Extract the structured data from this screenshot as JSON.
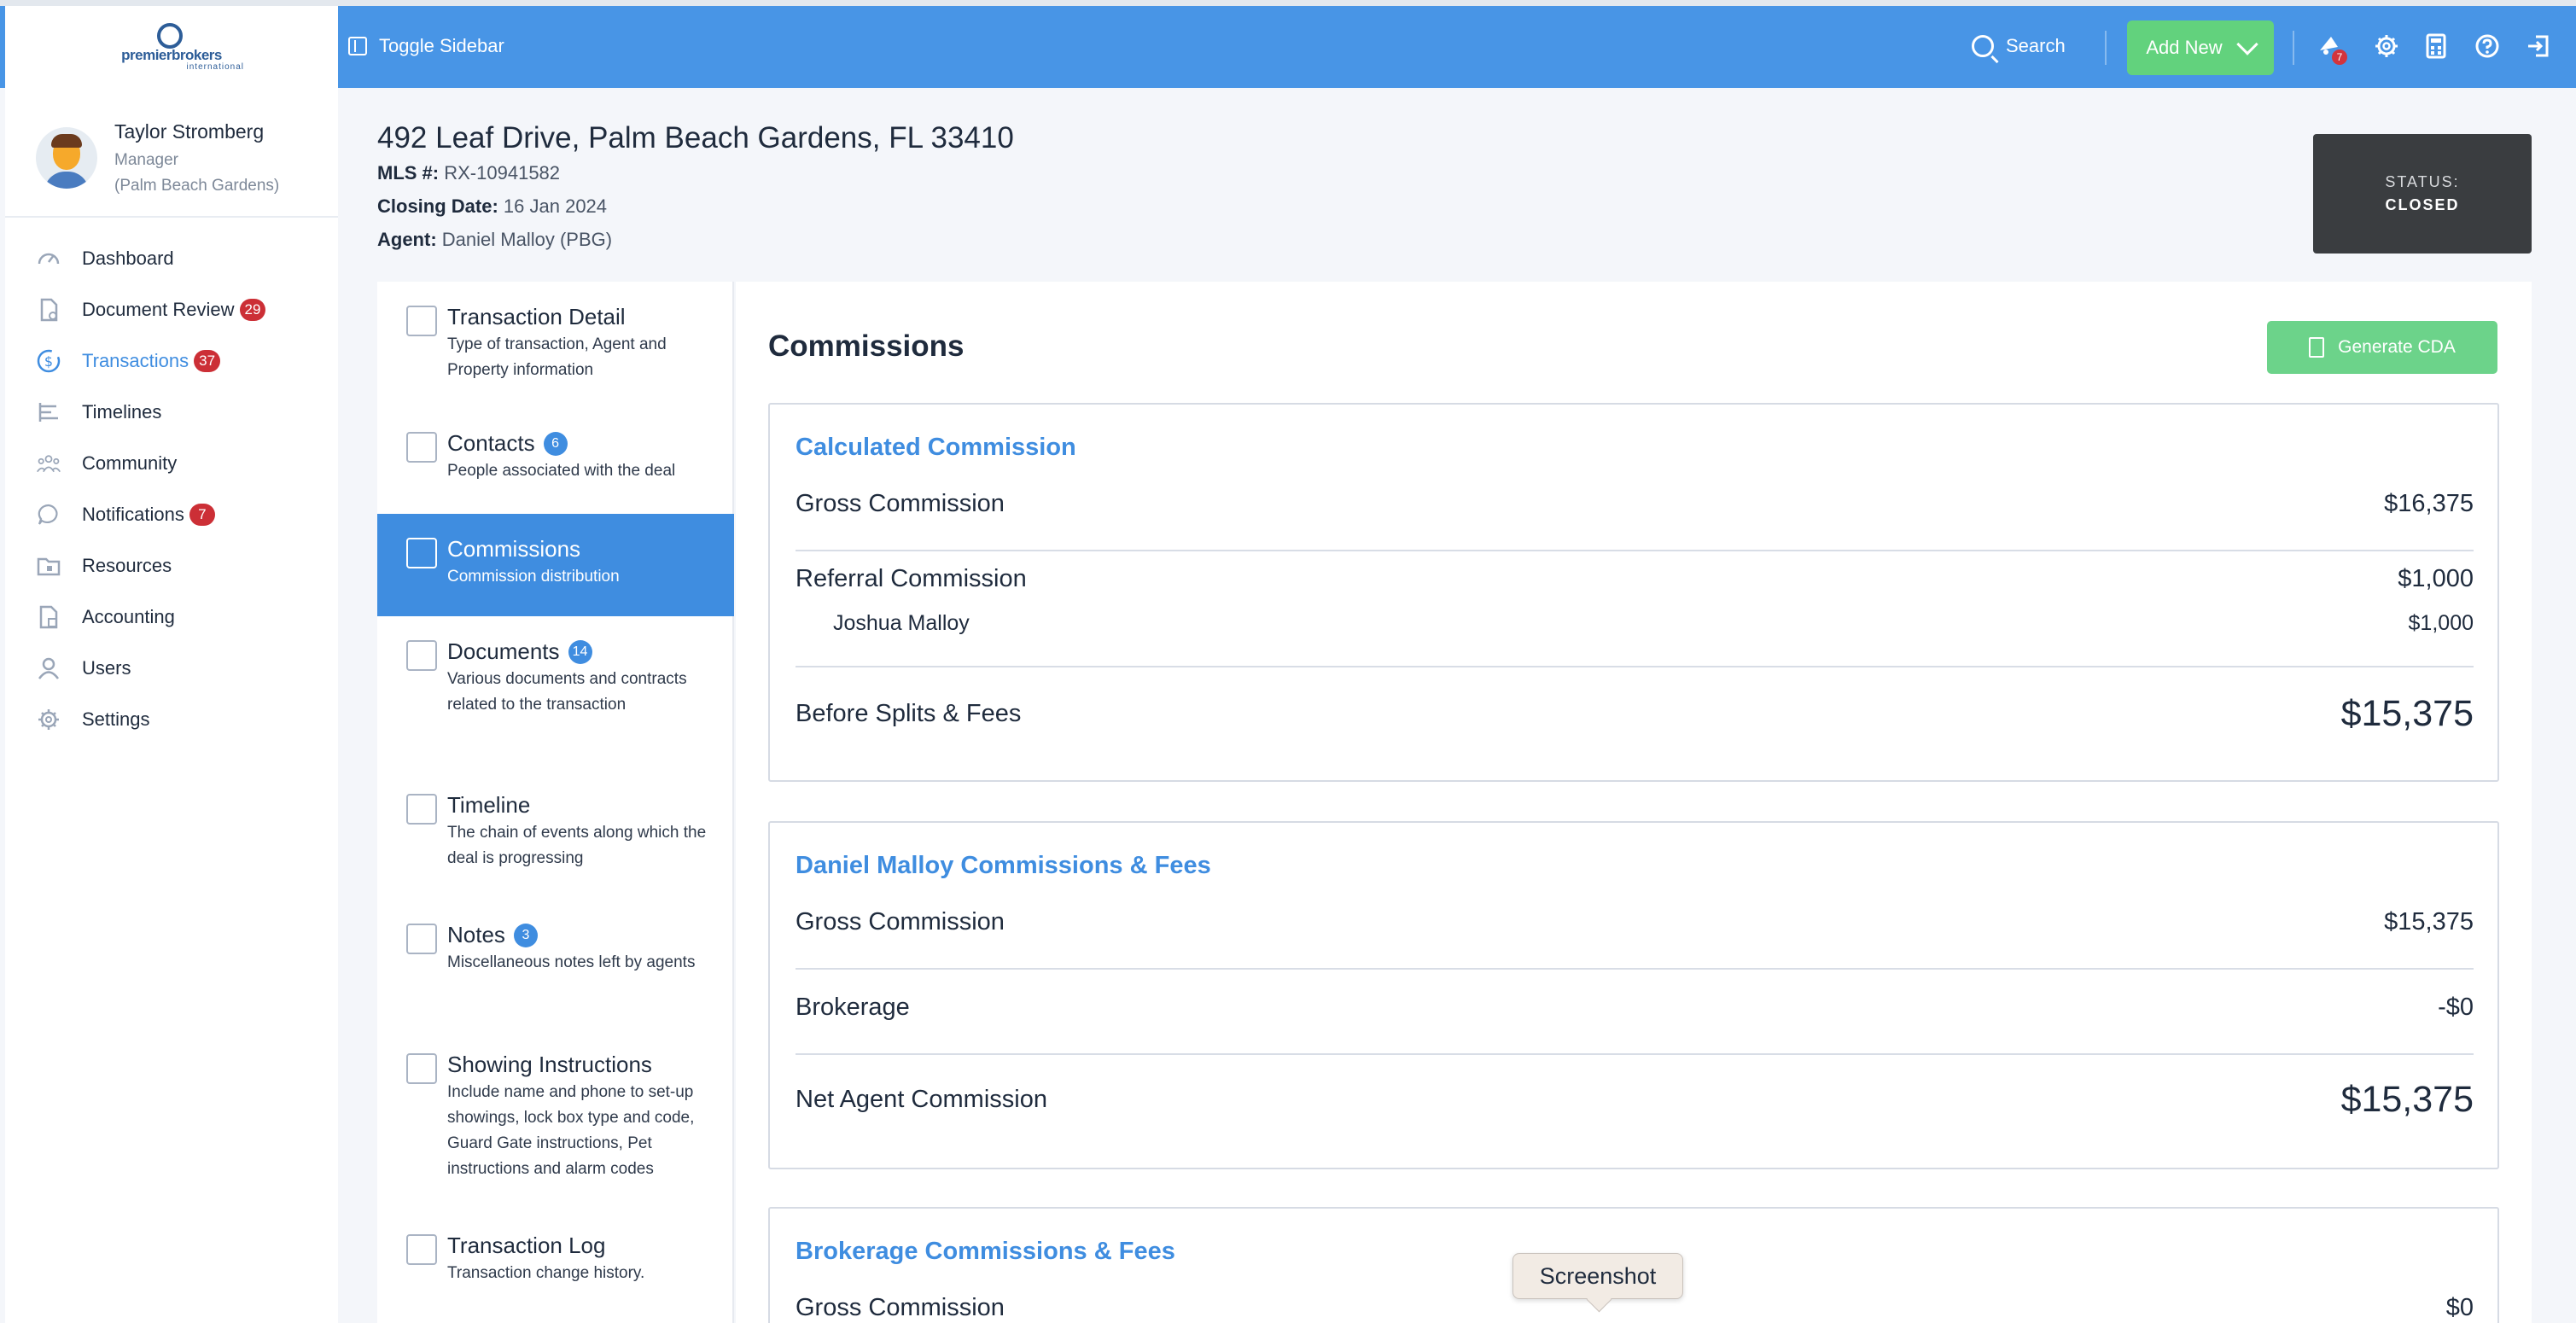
{
  "topbar": {
    "logo_word": "premierbrokers",
    "logo_sub": "international",
    "toggle_label": "Toggle Sidebar",
    "search_label": "Search",
    "add_new_label": "Add New",
    "alerts_badge": "7",
    "icons": [
      "toggle-sidebar-icon",
      "search-icon",
      "chevron-down-icon",
      "alerts-icon",
      "gear-icon",
      "calculator-icon",
      "help-icon",
      "logout-icon"
    ]
  },
  "user": {
    "name": "Taylor Stromberg",
    "role": "Manager",
    "location": "(Palm Beach Gardens)"
  },
  "nav": [
    {
      "label": "Dashboard",
      "badge": "",
      "icon": "dashboard-icon"
    },
    {
      "label": "Document Review",
      "badge": "29",
      "icon": "document-review-icon"
    },
    {
      "label": "Transactions",
      "badge": "37",
      "icon": "dollar-icon",
      "active": true
    },
    {
      "label": "Timelines",
      "badge": "",
      "icon": "timeline-icon"
    },
    {
      "label": "Community",
      "badge": "",
      "icon": "community-icon"
    },
    {
      "label": "Notifications",
      "badge": "7",
      "icon": "chat-icon"
    },
    {
      "label": "Resources",
      "badge": "",
      "icon": "folder-icon"
    },
    {
      "label": "Accounting",
      "badge": "",
      "icon": "accounting-icon"
    },
    {
      "label": "Users",
      "badge": "",
      "icon": "user-icon"
    },
    {
      "label": "Settings",
      "badge": "",
      "icon": "gear-icon"
    }
  ],
  "transaction": {
    "address": "492 Leaf Drive, Palm Beach Gardens, FL 33410",
    "mls_label": "MLS #:",
    "mls_value": "RX-10941582",
    "closing_label": "Closing Date:",
    "closing_value": "16 Jan 2024",
    "agent_label": "Agent:",
    "agent_value": "Daniel Malloy (PBG)",
    "status_label": "STATUS:",
    "status_value": "CLOSED"
  },
  "tabs": [
    {
      "title": "Transaction Detail",
      "badge": "",
      "desc": "Type of transaction, Agent and Property information",
      "icon": "building-icon"
    },
    {
      "title": "Contacts",
      "badge": "6",
      "desc": "People associated with the deal",
      "icon": "phone-book-icon"
    },
    {
      "title": "Commissions",
      "badge": "",
      "desc": "Commission distribution",
      "icon": "hand-money-icon",
      "active": true
    },
    {
      "title": "Documents",
      "badge": "14",
      "desc": "Various documents and contracts related to the transaction",
      "icon": "document-icon"
    },
    {
      "title": "Timeline",
      "badge": "",
      "desc": "The chain of events along which the deal is progressing",
      "icon": "timeline-icon"
    },
    {
      "title": "Notes",
      "badge": "3",
      "desc": "Miscellaneous notes left by agents",
      "icon": "note-icon"
    },
    {
      "title": "Showing Instructions",
      "badge": "",
      "desc": "Include name and phone to set-up showings, lock box type and code, Guard Gate instructions, Pet instructions and alarm codes",
      "icon": "house-icon"
    },
    {
      "title": "Transaction Log",
      "badge": "",
      "desc": "Transaction change history.",
      "icon": "log-icon"
    }
  ],
  "commissions": {
    "title": "Commissions",
    "generate_cda": "Generate CDA",
    "calculated": {
      "heading": "Calculated Commission",
      "gross_label": "Gross Commission",
      "gross_value": "$16,375",
      "referral_label": "Referral Commission",
      "referral_value": "$1,000",
      "referral_person": "Joshua Malloy",
      "referral_person_value": "$1,000",
      "before_label": "Before Splits & Fees",
      "before_value": "$15,375"
    },
    "agent": {
      "heading": "Daniel Malloy Commissions & Fees",
      "gross_label": "Gross Commission",
      "gross_value": "$15,375",
      "brokerage_label": "Brokerage",
      "brokerage_value": "-$0",
      "net_label": "Net Agent Commission",
      "net_value": "$15,375"
    },
    "brokerage": {
      "heading": "Brokerage Commissions & Fees",
      "gross_label": "Gross Commission",
      "gross_value": "$0"
    }
  },
  "tooltip": "Screenshot"
}
